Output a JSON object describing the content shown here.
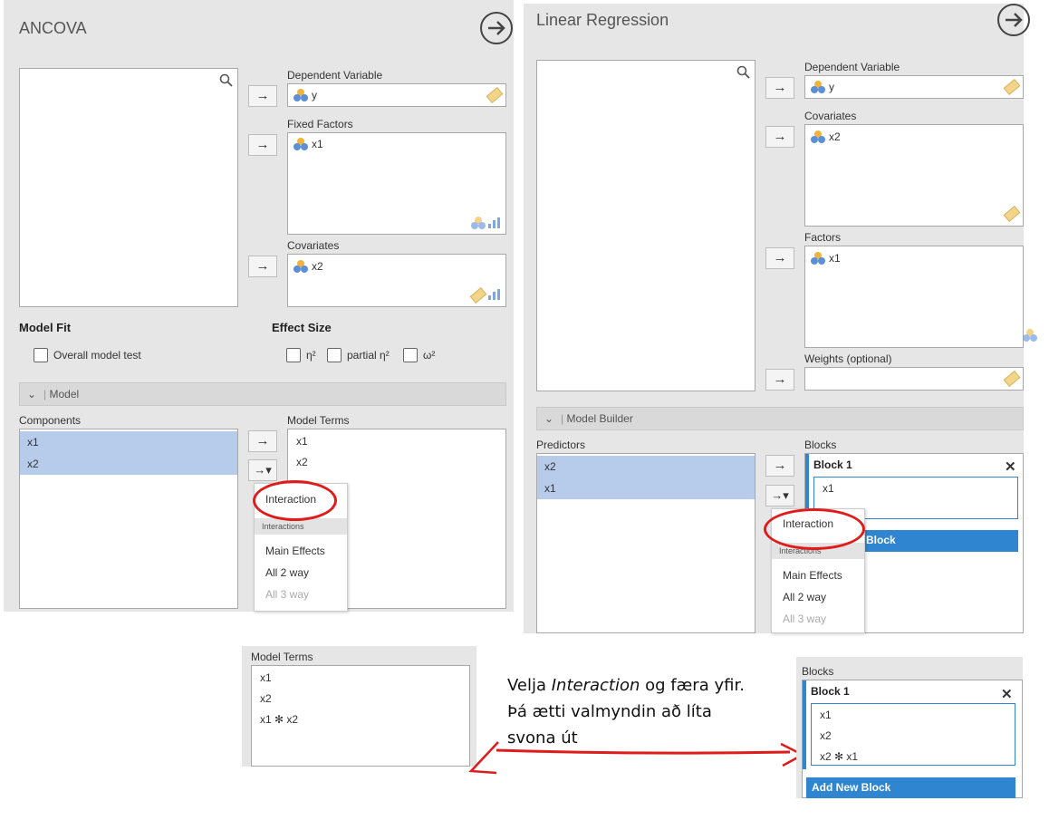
{
  "ancova": {
    "title": "ANCOVA",
    "dependent_label": "Dependent Variable",
    "dependent_var": "y",
    "fixed_label": "Fixed Factors",
    "fixed_var": "x1",
    "covariates_label": "Covariates",
    "covariate_var": "x2",
    "model_fit_label": "Model Fit",
    "overall_test_label": "Overall model test",
    "effect_size_label": "Effect Size",
    "eta_label": "η²",
    "partial_eta_label": "partial η²",
    "omega_label": "ω²",
    "model_section_label": "Model",
    "components_label": "Components",
    "components": [
      "x1",
      "x2"
    ],
    "model_terms_label": "Model Terms",
    "model_terms": [
      "x1",
      "x2"
    ],
    "menu": {
      "interaction": "Interaction",
      "header": "Interactions",
      "main_effects": "Main Effects",
      "all_2_way": "All 2 way",
      "all_3_way": "All 3 way"
    }
  },
  "linreg": {
    "title": "Linear Regression",
    "dependent_label": "Dependent Variable",
    "dependent_var": "y",
    "covariates_label": "Covariates",
    "covariate_var": "x2",
    "factors_label": "Factors",
    "factor_var": "x1",
    "weights_label": "Weights (optional)",
    "model_builder_label": "Model Builder",
    "predictors_label": "Predictors",
    "predictors": [
      "x2",
      "x1"
    ],
    "blocks_label": "Blocks",
    "block_title": "Block 1",
    "block_items": [
      "x1"
    ],
    "add_block_label": "Block",
    "menu": {
      "interaction": "Interaction",
      "header": "Interactions",
      "main_effects": "Main Effects",
      "all_2_way": "All 2 way",
      "all_3_way": "All 3 way"
    }
  },
  "result_ancova": {
    "label": "Model Terms",
    "terms": [
      "x1",
      "x2",
      "x1 ✻ x2"
    ]
  },
  "result_linreg": {
    "label": "Blocks",
    "block_title": "Block 1",
    "items": [
      "x1",
      "x2",
      "x2 ✻ x1"
    ],
    "add_block_label": "Add New Block"
  },
  "annotation": {
    "line1_pre": "Velja ",
    "line1_em": "Interaction",
    "line1_post": " og færa yfir.",
    "line2": "Þá ætti valmyndin að líta",
    "line3": "svona út"
  },
  "colors": {
    "panel": "#e6e6e6",
    "selected": "#b7cbea",
    "accent_blue": "#2f85cf",
    "highlight_red": "#e01b1b"
  }
}
